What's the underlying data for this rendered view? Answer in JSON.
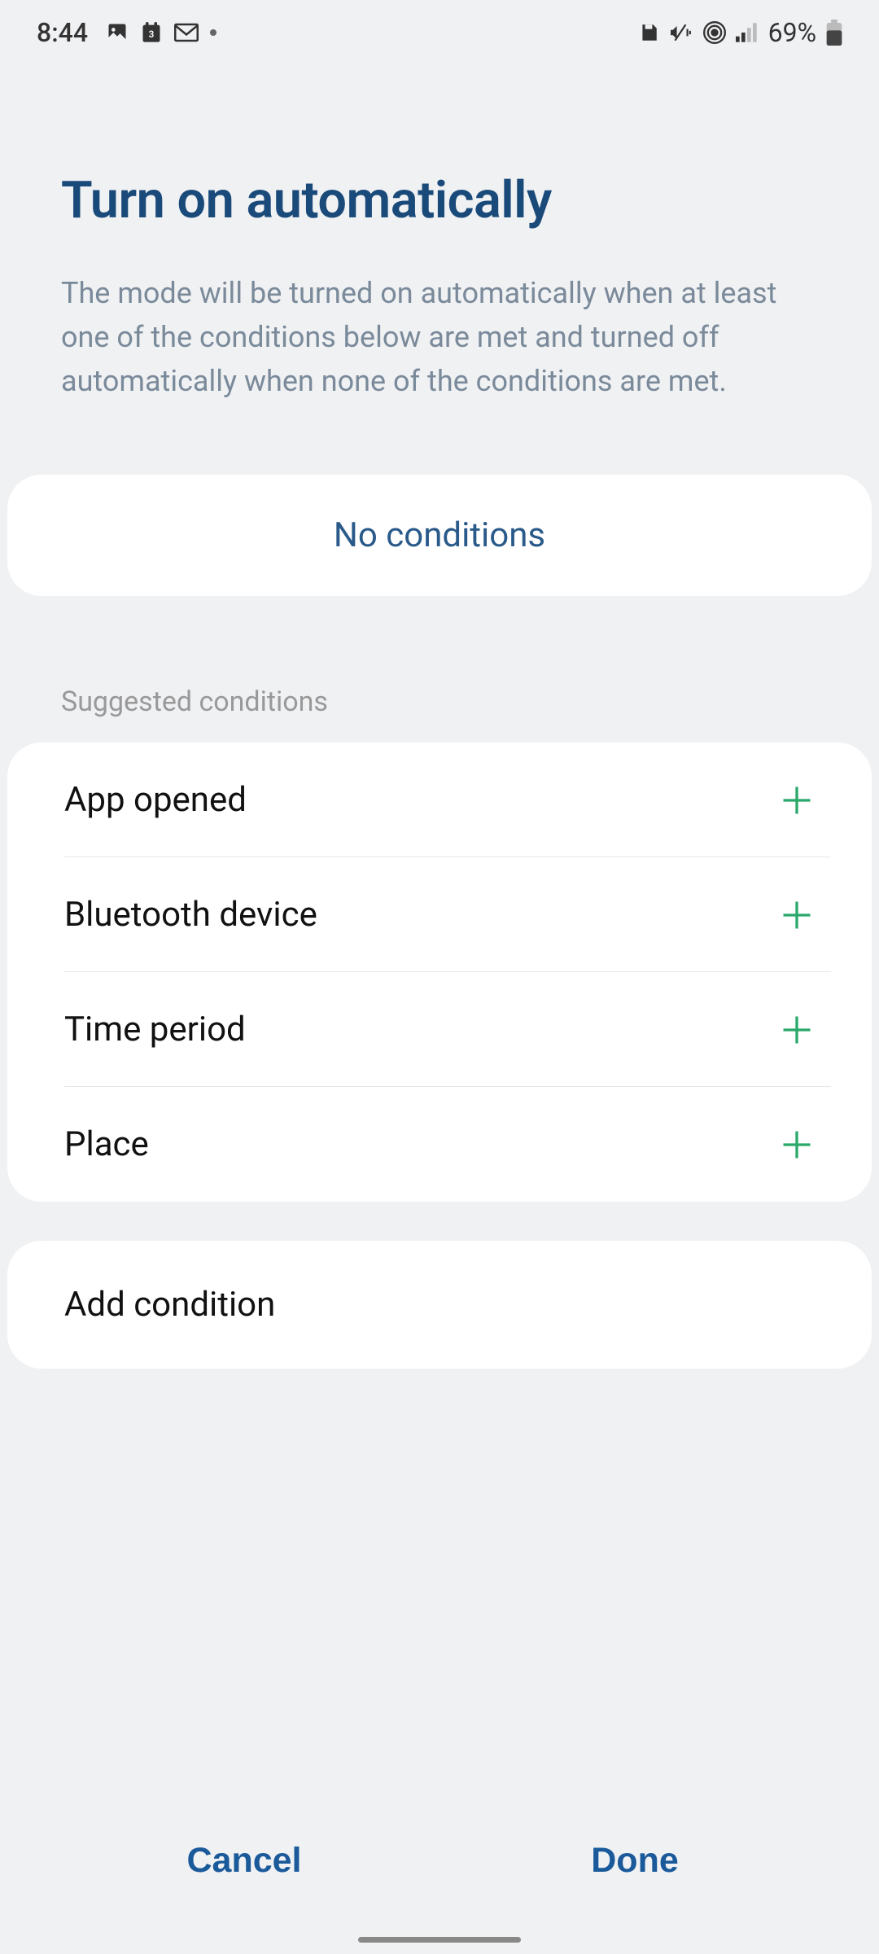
{
  "status_bar": {
    "time": "8:44",
    "battery": "69%"
  },
  "header": {
    "title": "Turn on automatically",
    "description": "The mode will be turned on automatically when at least one of the conditions below are met and turned off automatically when none of the conditions are met."
  },
  "conditions_card": {
    "text": "No conditions"
  },
  "suggested": {
    "header": "Suggested conditions",
    "items": [
      {
        "label": "App opened"
      },
      {
        "label": "Bluetooth device"
      },
      {
        "label": "Time period"
      },
      {
        "label": "Place"
      }
    ]
  },
  "add_condition": {
    "label": "Add condition"
  },
  "footer": {
    "cancel": "Cancel",
    "done": "Done"
  }
}
